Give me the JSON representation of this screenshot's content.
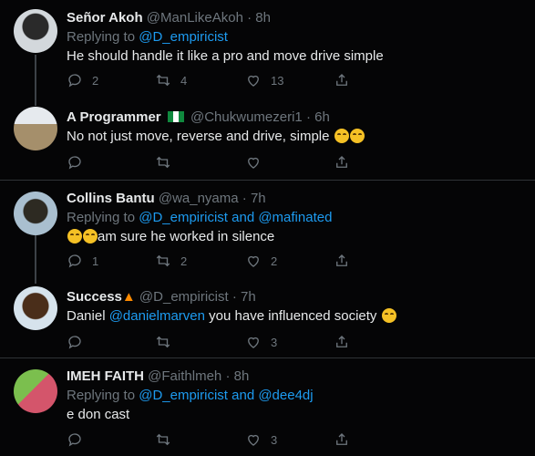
{
  "tweets": [
    {
      "name": "Señor Akoh",
      "handle": "@ManLikeAkoh",
      "time": "· 8h",
      "replying_prefix": "Replying to ",
      "replying_to": "@D_empiricist",
      "text": "He should handle it like a pro and move drive simple",
      "replies": "2",
      "retweets": "4",
      "likes": "13",
      "avatar_colors": [
        "#c9d0d6",
        "#1c2024"
      ]
    },
    {
      "name": "A Programmer",
      "handle": "@Chukwumezeri1",
      "time": "· 6h",
      "text": "No not just move, reverse and drive, simple",
      "replies": "",
      "retweets": "",
      "likes": "",
      "avatar_colors": [
        "#b7a58a",
        "#e9edf1"
      ]
    },
    {
      "name": "Collins Bantu",
      "handle": "@wa_nyama",
      "time": "· 7h",
      "replying_prefix": "Replying to ",
      "replying_to": "@D_empiricist and @mafinated",
      "text": "am sure he worked in silence",
      "replies": "1",
      "retweets": "2",
      "likes": "2",
      "avatar_colors": [
        "#9bb3c4",
        "#2f3a2a"
      ]
    },
    {
      "name": "Success",
      "handle": "@D_empiricist",
      "time": "· 7h",
      "text_prefix": "Daniel ",
      "text_mention": "@danielmarven",
      "text_suffix": " you have influenced society",
      "replies": "",
      "retweets": "",
      "likes": "3",
      "avatar_colors": [
        "#c7d8e6",
        "#3a2516"
      ]
    },
    {
      "name": "IMEH FAITH",
      "handle": "@Faithlmeh",
      "time": "· 8h",
      "replying_prefix": "Replying to ",
      "replying_to": "@D_empiricist and @dee4dj",
      "text": "e don cast",
      "replies": "",
      "retweets": "",
      "likes": "3",
      "avatar_colors": [
        "#d4556b",
        "#7bbf4e"
      ]
    }
  ],
  "icons": {
    "reply": "reply-icon",
    "retweet": "retweet-icon",
    "like": "heart-icon",
    "share": "share-icon",
    "more": "more-icon"
  },
  "colors": {
    "link": "#1d9bf0",
    "muted": "#6e767d",
    "background": "#050506"
  }
}
